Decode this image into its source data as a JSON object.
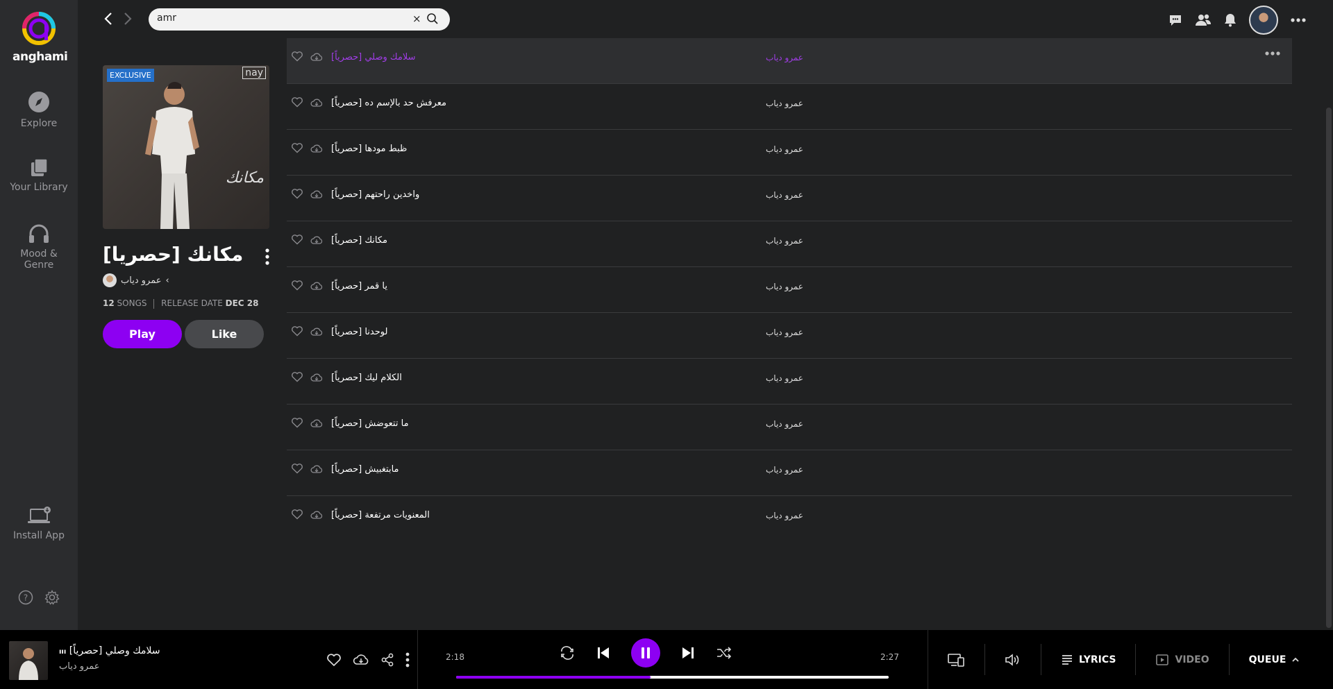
{
  "brand": {
    "name": "anghami"
  },
  "nav": {
    "items": [
      {
        "label": "Explore",
        "icon": "explore-icon"
      },
      {
        "label": "Your Library",
        "icon": "library-icon"
      },
      {
        "label": "Mood &",
        "label2": "Genre",
        "icon": "headphones-icon"
      },
      {
        "label": "Install App",
        "icon": "laptop-icon"
      }
    ]
  },
  "search": {
    "value": "amr",
    "clear": "×"
  },
  "album": {
    "badge": "EXCLUSIVE",
    "cover_logo": "nay",
    "cover_sign": "مكانك",
    "title": "مكانك [حصريا]",
    "artist": "عمرو دياب",
    "song_count": "12",
    "songs_label": "SONGS",
    "release_label": "RELEASE DATE",
    "release_date": "DEC 28",
    "play_label": "Play",
    "like_label": "Like"
  },
  "tracks": [
    {
      "name": "سلامك وصلي [حصرياً]",
      "artist": "عمرو دياب",
      "active": true
    },
    {
      "name": "معرفش حد بالإسم ده [حصرياً]",
      "artist": "عمرو دياب"
    },
    {
      "name": "ظبط مودها [حصرياً]",
      "artist": "عمرو دياب"
    },
    {
      "name": "واخدين راحتهم [حصرياً]",
      "artist": "عمرو دياب"
    },
    {
      "name": "مكانك [حصرياً]",
      "artist": "عمرو دياب"
    },
    {
      "name": "يا قمر [حصرياً]",
      "artist": "عمرو دياب"
    },
    {
      "name": "لوحدنا [حصرياً]",
      "artist": "عمرو دياب"
    },
    {
      "name": "الكلام ليك [حصرياً]",
      "artist": "عمرو دياب"
    },
    {
      "name": "ما تتعوضش [حصرياً]",
      "artist": "عمرو دياب"
    },
    {
      "name": "مابتغبيش [حصرياً]",
      "artist": "عمرو دياب"
    },
    {
      "name": "المعنويات مرتفعة [حصرياً]",
      "artist": "عمرو دياب"
    }
  ],
  "player": {
    "title": "سلامك وصلي [حصرياً]",
    "artist": "عمرو دياب",
    "elapsed": "2:18",
    "duration": "2:27",
    "progress": 0.45,
    "lyrics_label": "LYRICS",
    "video_label": "VIDEO",
    "queue_label": "QUEUE"
  },
  "colors": {
    "accent": "#8d00f2",
    "active_text": "#a13de8",
    "exclusive": "#2570c9"
  }
}
